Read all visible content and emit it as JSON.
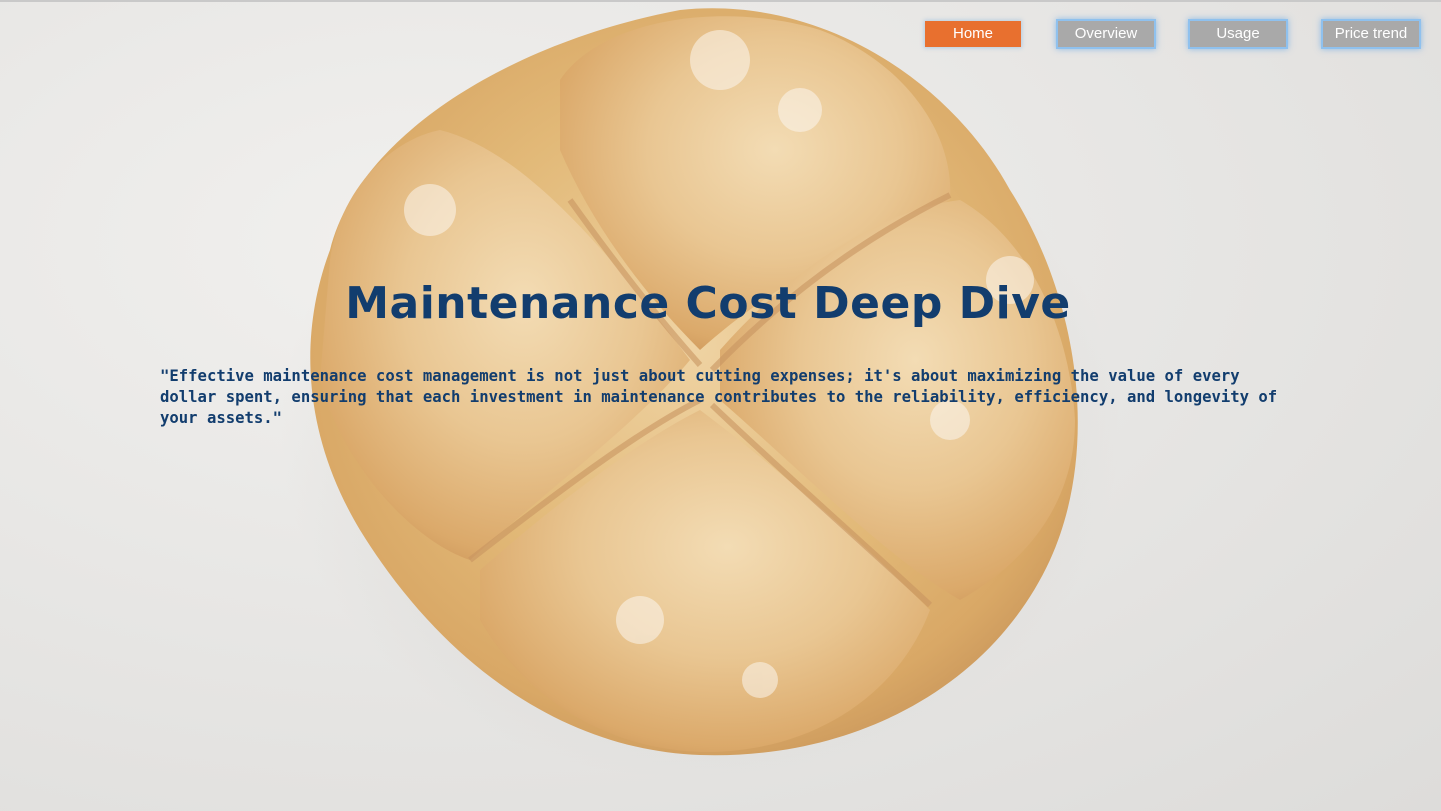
{
  "nav": {
    "items": [
      {
        "label": "Home",
        "active": true
      },
      {
        "label": "Overview",
        "active": false
      },
      {
        "label": "Usage",
        "active": false
      },
      {
        "label": "Price trend",
        "active": false
      }
    ]
  },
  "hero": {
    "title": "Maintenance Cost Deep Dive",
    "quote": "\"Effective maintenance cost management is not just about cutting expenses; it's about maximizing the value of every dollar spent, ensuring that each investment in maintenance contributes to the reliability, efficiency, and longevity of your assets.\""
  },
  "colors": {
    "active_tab": "#e8702f",
    "inactive_tab": "#a9a9a9",
    "tab_glow": "#8fc1ee",
    "text_primary": "#123d6e"
  },
  "background_image": "bread-roll-photo"
}
